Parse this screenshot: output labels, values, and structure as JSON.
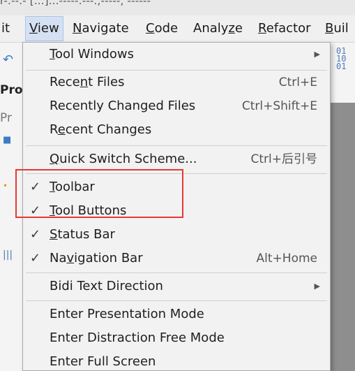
{
  "title_bar": {
    "text": "r-.--.- [...]...-----.---.,-----, ------"
  },
  "menubar": {
    "items": [
      {
        "label_pre": "",
        "label_mn": "",
        "label_post": "it"
      },
      {
        "label_pre": "",
        "label_mn": "V",
        "label_post": "iew"
      },
      {
        "label_pre": "",
        "label_mn": "N",
        "label_post": "avigate"
      },
      {
        "label_pre": "",
        "label_mn": "C",
        "label_post": "ode"
      },
      {
        "label_pre": "Analy",
        "label_mn": "z",
        "label_post": "e"
      },
      {
        "label_pre": "",
        "label_mn": "R",
        "label_post": "efactor"
      },
      {
        "label_pre": "",
        "label_mn": "B",
        "label_post": "uil"
      }
    ]
  },
  "left_pane": {
    "tab_text": "Pro",
    "tab_text_2": "Pr"
  },
  "view_menu": {
    "tool_windows": {
      "pre": "",
      "mn": "T",
      "post": "ool Windows"
    },
    "recent_files": {
      "pre": "Rece",
      "mn": "n",
      "post": "t Files",
      "shortcut": "Ctrl+E"
    },
    "recently_changed_files": {
      "pre": "Recently Changed Files",
      "shortcut": "Ctrl+Shift+E"
    },
    "recent_changes": {
      "pre": "R",
      "mn": "e",
      "post": "cent Changes"
    },
    "quick_switch_scheme": {
      "pre": "",
      "mn": "Q",
      "post": "uick Switch Scheme...",
      "shortcut": "Ctrl+后引号"
    },
    "toolbar": {
      "check": "✓",
      "pre": "",
      "mn": "T",
      "post": "oolbar"
    },
    "tool_buttons": {
      "check": "✓",
      "pre": "",
      "mn": "T",
      "post": "ool Buttons"
    },
    "status_bar": {
      "check": "✓",
      "pre": "",
      "mn": "S",
      "post": "tatus Bar"
    },
    "navigation_bar": {
      "check": "✓",
      "pre": "Na",
      "mn": "v",
      "post": "igation Bar",
      "shortcut": "Alt+Home"
    },
    "bidi_text_direction": {
      "label": "Bidi Text Direction"
    },
    "enter_presentation_mode": {
      "label": "Enter Presentation Mode"
    },
    "enter_distraction_free_mode": {
      "label": "Enter Distraction Free Mode"
    },
    "enter_full_screen": {
      "label": "Enter Full Screen"
    }
  },
  "colors": {
    "highlight_box": "#e53935",
    "menu_bg": "#f2f2f2",
    "active_menu_bg": "#d5e1f2"
  }
}
